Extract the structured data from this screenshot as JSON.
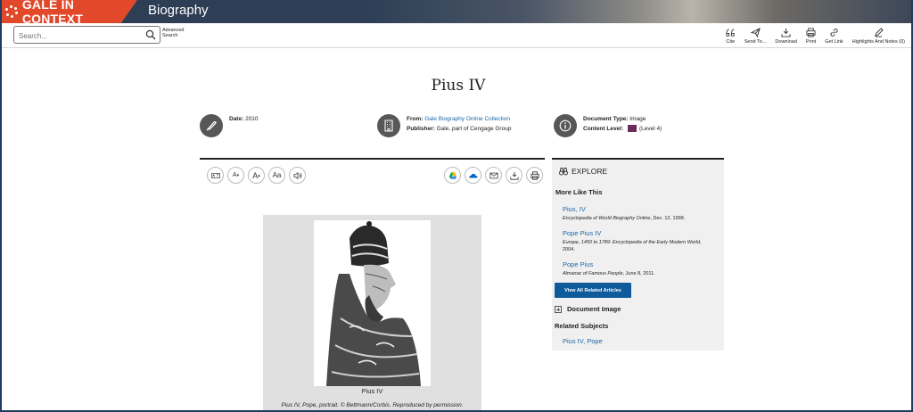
{
  "header": {
    "brand": "GALE IN CONTEXT",
    "product": "Biography",
    "brand_color": "#e2482a",
    "banner_color": "#2d3e55"
  },
  "search": {
    "placeholder": "Search...",
    "advanced_line1": "Advanced",
    "advanced_line2": "Search"
  },
  "tools": [
    {
      "label": "Cite",
      "icon": "cite-icon"
    },
    {
      "label": "Send To...",
      "icon": "send-icon"
    },
    {
      "label": "Download",
      "icon": "download-icon"
    },
    {
      "label": "Print",
      "icon": "print-icon"
    },
    {
      "label": "Get Link",
      "icon": "link-icon"
    },
    {
      "label": "Highlights And Notes (0)",
      "icon": "pencil-icon"
    }
  ],
  "document": {
    "title": "Pius IV",
    "date_label": "Date:",
    "date_value": "2010",
    "from_label": "From:",
    "from_value": "Gale Biography Online Collection",
    "publisher_label": "Publisher:",
    "publisher_value": "Gale, part of Cengage Group",
    "type_label": "Document Type:",
    "type_value": "Image",
    "level_label": "Content Level:",
    "level_value": "(Level 4)"
  },
  "reader_tools": [
    "translate",
    "A-",
    "A-",
    "Aa",
    "listen"
  ],
  "figure": {
    "caption": "Pius IV",
    "credit": "Pius IV, Pope, portrait. © Bettmann/Corbis. Reproduced by permission."
  },
  "explore": {
    "heading": "EXPLORE",
    "more_like_this": "More Like This",
    "items": [
      {
        "title": "Pius, IV",
        "source_italic": "Encyclopedia of World Biography Online",
        "source_rest": ", Dec. 12, 1998."
      },
      {
        "title": "Pope Pius IV",
        "source_italic": "Europe, 1450 to 1789: Encyclopedia of the Early Modern World",
        "source_rest": ", 2004."
      },
      {
        "title": "Pope Pius",
        "source_italic": "Almanac of Famous People",
        "source_rest": ", June 8, 2011."
      }
    ],
    "view_all": "View All Related Articles",
    "document_image": "Document Image",
    "related_subjects": "Related Subjects",
    "related_link": "Pius IV, Pope"
  },
  "font_buttons": {
    "a_smaller": "A",
    "a_larger": "A",
    "aa": "Aa"
  }
}
